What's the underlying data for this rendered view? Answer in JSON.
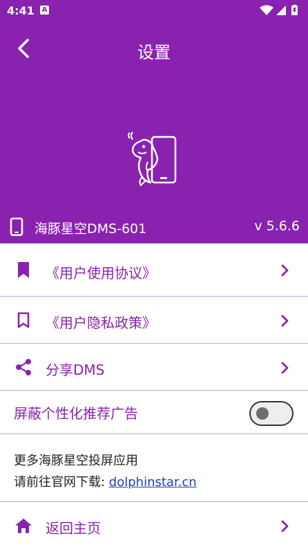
{
  "status_bar": {
    "time": "4:41",
    "notification_icon": "a-badge-icon",
    "icons": [
      "wifi-icon",
      "signal-icon",
      "battery-icon"
    ]
  },
  "header": {
    "title": "设置",
    "back_icon": "chevron-left-icon",
    "logo_icon": "dolphin-phone-logo-icon",
    "device_name": "海豚星空DMS-601",
    "version": "v 5.6.6",
    "background_color": "#8a22b0"
  },
  "menu": {
    "items": [
      {
        "label": "《用户使用协议》",
        "icon": "bookmark-filled-icon"
      },
      {
        "label": "《用户隐私政策》",
        "icon": "bookmark-outline-icon"
      },
      {
        "label": "分享DMS",
        "icon": "share-icon"
      }
    ]
  },
  "ad_setting": {
    "label": "屏蔽个性化推荐广告",
    "enabled": false
  },
  "info": {
    "line1": "更多海豚星空投屏应用",
    "line2_prefix": "请前往官网下载: ",
    "link": "dolphinstar.cn"
  },
  "home": {
    "label": "返回主页",
    "icon": "home-icon"
  },
  "colors": {
    "accent": "#8a22b0",
    "divider": "#c9a4d6",
    "link": "#1a3dc2"
  }
}
